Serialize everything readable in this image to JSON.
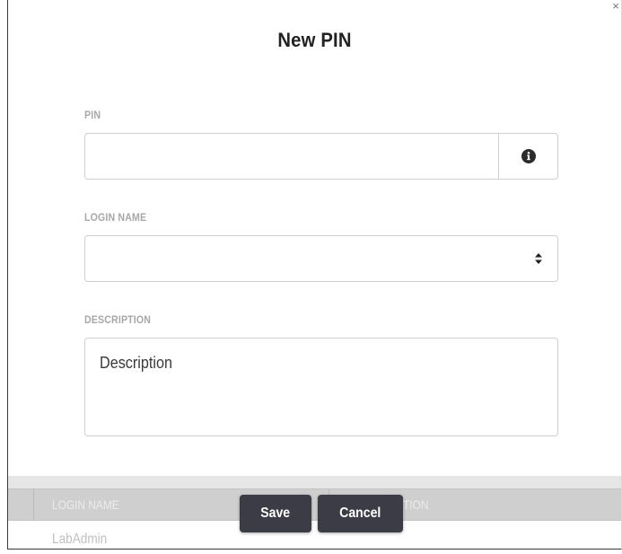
{
  "dialog": {
    "title": "New PIN",
    "close_label": "×",
    "fields": {
      "pin": {
        "label": "PIN",
        "value": "",
        "info_icon": "info-circle-icon"
      },
      "login_name": {
        "label": "LOGIN NAME",
        "selected_value": "",
        "arrows_icon": "sort-updown-icon"
      },
      "description": {
        "label": "DESCRIPTION",
        "placeholder": "Description",
        "value": ""
      }
    },
    "buttons": {
      "save_label": "Save",
      "cancel_label": "Cancel"
    }
  },
  "background_table": {
    "columns": [
      "LOGIN NAME",
      "TION"
    ],
    "rows": [
      [
        "LabAdmin"
      ]
    ]
  },
  "colors": {
    "button_bg": "#3c3c46",
    "label_gray": "#a7a7a7",
    "border": "#cfcfcf"
  }
}
